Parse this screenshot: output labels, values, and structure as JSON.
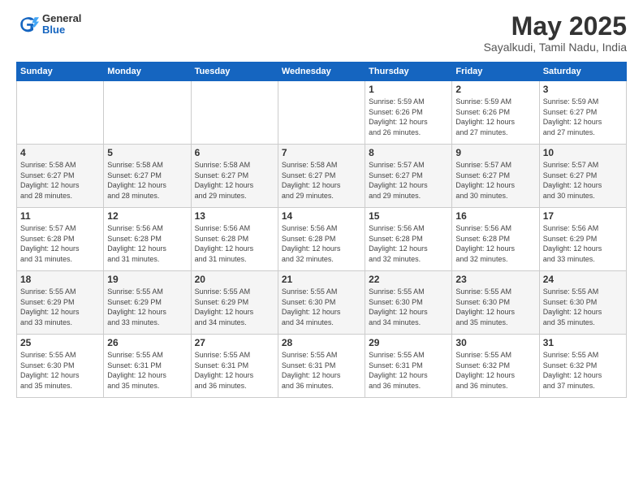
{
  "logo": {
    "general": "General",
    "blue": "Blue"
  },
  "title": "May 2025",
  "location": "Sayalkudi, Tamil Nadu, India",
  "headers": [
    "Sunday",
    "Monday",
    "Tuesday",
    "Wednesday",
    "Thursday",
    "Friday",
    "Saturday"
  ],
  "weeks": [
    [
      {
        "day": "",
        "info": ""
      },
      {
        "day": "",
        "info": ""
      },
      {
        "day": "",
        "info": ""
      },
      {
        "day": "",
        "info": ""
      },
      {
        "day": "1",
        "info": "Sunrise: 5:59 AM\nSunset: 6:26 PM\nDaylight: 12 hours\nand 26 minutes."
      },
      {
        "day": "2",
        "info": "Sunrise: 5:59 AM\nSunset: 6:26 PM\nDaylight: 12 hours\nand 27 minutes."
      },
      {
        "day": "3",
        "info": "Sunrise: 5:59 AM\nSunset: 6:27 PM\nDaylight: 12 hours\nand 27 minutes."
      }
    ],
    [
      {
        "day": "4",
        "info": "Sunrise: 5:58 AM\nSunset: 6:27 PM\nDaylight: 12 hours\nand 28 minutes."
      },
      {
        "day": "5",
        "info": "Sunrise: 5:58 AM\nSunset: 6:27 PM\nDaylight: 12 hours\nand 28 minutes."
      },
      {
        "day": "6",
        "info": "Sunrise: 5:58 AM\nSunset: 6:27 PM\nDaylight: 12 hours\nand 29 minutes."
      },
      {
        "day": "7",
        "info": "Sunrise: 5:58 AM\nSunset: 6:27 PM\nDaylight: 12 hours\nand 29 minutes."
      },
      {
        "day": "8",
        "info": "Sunrise: 5:57 AM\nSunset: 6:27 PM\nDaylight: 12 hours\nand 29 minutes."
      },
      {
        "day": "9",
        "info": "Sunrise: 5:57 AM\nSunset: 6:27 PM\nDaylight: 12 hours\nand 30 minutes."
      },
      {
        "day": "10",
        "info": "Sunrise: 5:57 AM\nSunset: 6:27 PM\nDaylight: 12 hours\nand 30 minutes."
      }
    ],
    [
      {
        "day": "11",
        "info": "Sunrise: 5:57 AM\nSunset: 6:28 PM\nDaylight: 12 hours\nand 31 minutes."
      },
      {
        "day": "12",
        "info": "Sunrise: 5:56 AM\nSunset: 6:28 PM\nDaylight: 12 hours\nand 31 minutes."
      },
      {
        "day": "13",
        "info": "Sunrise: 5:56 AM\nSunset: 6:28 PM\nDaylight: 12 hours\nand 31 minutes."
      },
      {
        "day": "14",
        "info": "Sunrise: 5:56 AM\nSunset: 6:28 PM\nDaylight: 12 hours\nand 32 minutes."
      },
      {
        "day": "15",
        "info": "Sunrise: 5:56 AM\nSunset: 6:28 PM\nDaylight: 12 hours\nand 32 minutes."
      },
      {
        "day": "16",
        "info": "Sunrise: 5:56 AM\nSunset: 6:28 PM\nDaylight: 12 hours\nand 32 minutes."
      },
      {
        "day": "17",
        "info": "Sunrise: 5:56 AM\nSunset: 6:29 PM\nDaylight: 12 hours\nand 33 minutes."
      }
    ],
    [
      {
        "day": "18",
        "info": "Sunrise: 5:55 AM\nSunset: 6:29 PM\nDaylight: 12 hours\nand 33 minutes."
      },
      {
        "day": "19",
        "info": "Sunrise: 5:55 AM\nSunset: 6:29 PM\nDaylight: 12 hours\nand 33 minutes."
      },
      {
        "day": "20",
        "info": "Sunrise: 5:55 AM\nSunset: 6:29 PM\nDaylight: 12 hours\nand 34 minutes."
      },
      {
        "day": "21",
        "info": "Sunrise: 5:55 AM\nSunset: 6:30 PM\nDaylight: 12 hours\nand 34 minutes."
      },
      {
        "day": "22",
        "info": "Sunrise: 5:55 AM\nSunset: 6:30 PM\nDaylight: 12 hours\nand 34 minutes."
      },
      {
        "day": "23",
        "info": "Sunrise: 5:55 AM\nSunset: 6:30 PM\nDaylight: 12 hours\nand 35 minutes."
      },
      {
        "day": "24",
        "info": "Sunrise: 5:55 AM\nSunset: 6:30 PM\nDaylight: 12 hours\nand 35 minutes."
      }
    ],
    [
      {
        "day": "25",
        "info": "Sunrise: 5:55 AM\nSunset: 6:30 PM\nDaylight: 12 hours\nand 35 minutes."
      },
      {
        "day": "26",
        "info": "Sunrise: 5:55 AM\nSunset: 6:31 PM\nDaylight: 12 hours\nand 35 minutes."
      },
      {
        "day": "27",
        "info": "Sunrise: 5:55 AM\nSunset: 6:31 PM\nDaylight: 12 hours\nand 36 minutes."
      },
      {
        "day": "28",
        "info": "Sunrise: 5:55 AM\nSunset: 6:31 PM\nDaylight: 12 hours\nand 36 minutes."
      },
      {
        "day": "29",
        "info": "Sunrise: 5:55 AM\nSunset: 6:31 PM\nDaylight: 12 hours\nand 36 minutes."
      },
      {
        "day": "30",
        "info": "Sunrise: 5:55 AM\nSunset: 6:32 PM\nDaylight: 12 hours\nand 36 minutes."
      },
      {
        "day": "31",
        "info": "Sunrise: 5:55 AM\nSunset: 6:32 PM\nDaylight: 12 hours\nand 37 minutes."
      }
    ]
  ]
}
